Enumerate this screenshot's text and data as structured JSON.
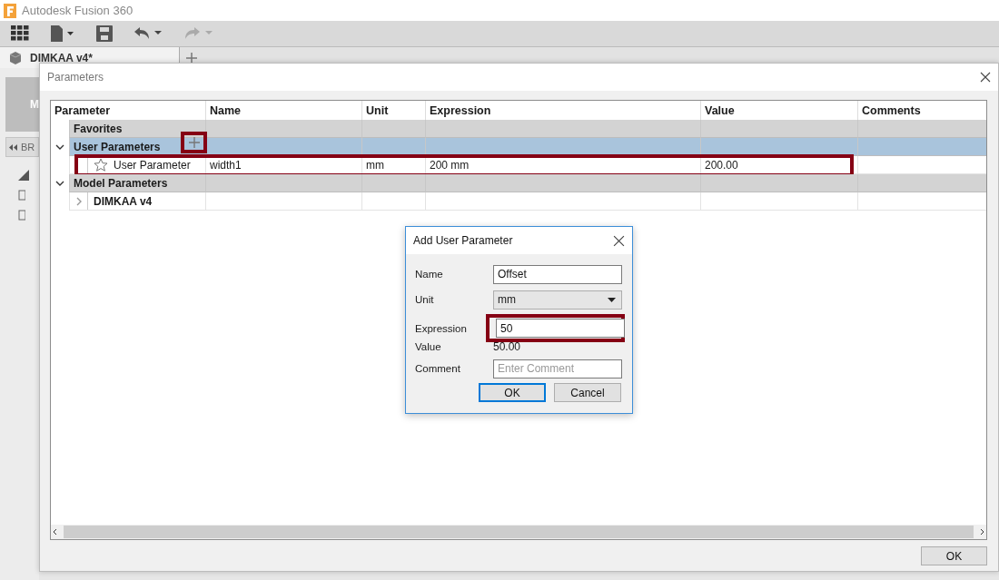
{
  "app": {
    "title": "Autodesk Fusion 360",
    "document_tab": {
      "label": "DIMKAA v4*"
    },
    "side_panel": {
      "heading": "M",
      "browser_label": "BR"
    }
  },
  "parameters_dialog": {
    "title": "Parameters",
    "columns": [
      "Parameter",
      "Name",
      "Unit",
      "Expression",
      "Value",
      "Comments"
    ],
    "rows": [
      {
        "kind": "group",
        "label": "Favorites",
        "selected": false
      },
      {
        "kind": "group",
        "label": "User Parameters",
        "expanded": true,
        "selected": true,
        "add_button": {
          "highlighted": true
        }
      },
      {
        "kind": "parameter",
        "label": "User Parameter",
        "name": "width1",
        "unit": "mm",
        "expression": "200 mm",
        "value": "200.00",
        "favorite": false,
        "selected": false,
        "highlighted": true
      },
      {
        "kind": "group",
        "label": "Model Parameters",
        "expanded": true,
        "selected": false
      },
      {
        "kind": "component",
        "label": "DIMKAA v4",
        "expanded": false,
        "selected": false
      }
    ],
    "ok_button": "OK"
  },
  "add_dialog": {
    "title": "Add User Parameter",
    "fields": [
      {
        "kind": "text",
        "label": "Name",
        "value": "Offset"
      },
      {
        "kind": "select",
        "label": "Unit",
        "value": "mm"
      },
      {
        "kind": "text",
        "label": "Expression",
        "value": "50",
        "highlighted": true
      },
      {
        "kind": "readout",
        "label": "Value",
        "value": "50.00"
      },
      {
        "kind": "text",
        "label": "Comment",
        "placeholder": "Enter Comment"
      }
    ],
    "buttons": [
      {
        "label": "OK",
        "default": true
      },
      {
        "label": "Cancel",
        "default": false
      }
    ]
  }
}
